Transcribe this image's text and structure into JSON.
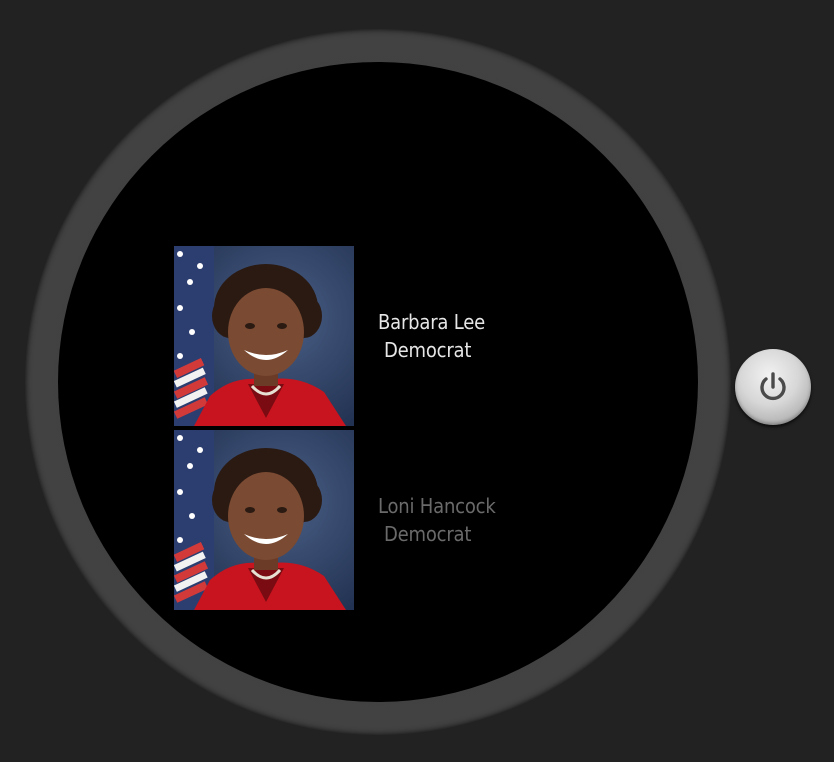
{
  "watch": {
    "list": [
      {
        "name": "Barbara Lee",
        "party": "Democrat",
        "photo_icon": "portrait-photo"
      },
      {
        "name": "Loni Hancock",
        "party": "Democrat",
        "photo_icon": "portrait-photo"
      }
    ],
    "power_button": {
      "icon": "power-icon"
    }
  },
  "colors": {
    "background": "#222222",
    "bezel": "#444444",
    "screen": "#000000",
    "text_primary": "#e6e6e6",
    "text_secondary": "#6a6a6a",
    "portrait_jacket": "#c8141e"
  }
}
